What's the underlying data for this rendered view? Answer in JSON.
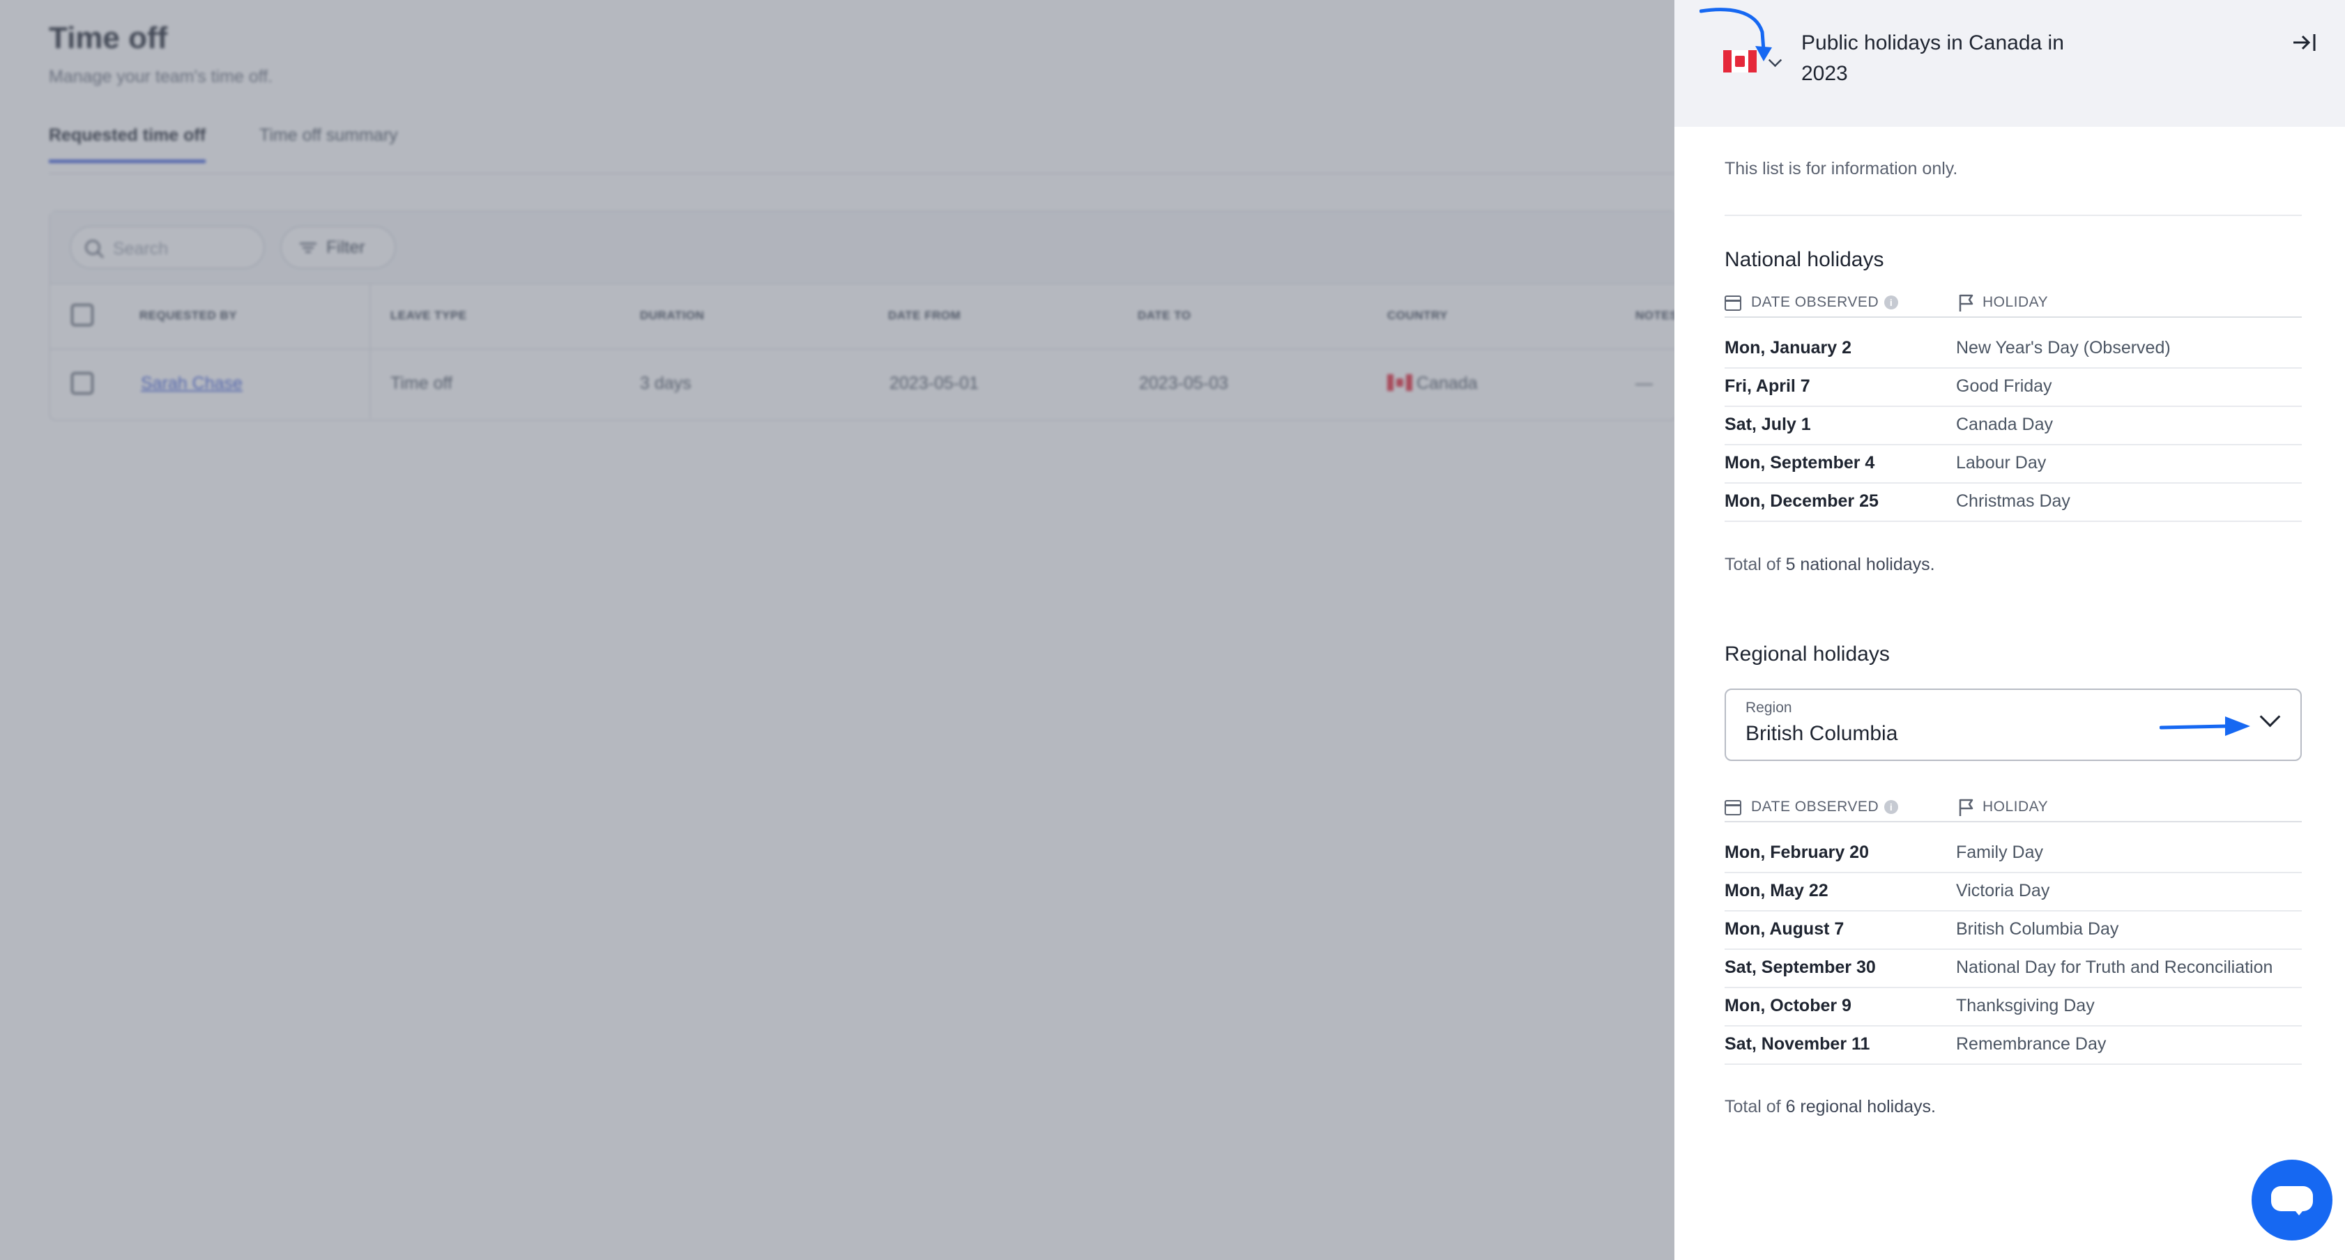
{
  "background": {
    "title": "Time off",
    "subtitle": "Manage your team's time off.",
    "tabs": [
      {
        "label": "Requested time off",
        "active": true
      },
      {
        "label": "Time off summary",
        "active": false
      }
    ],
    "search_placeholder": "Search",
    "filter_label": "Filter",
    "table": {
      "columns": [
        "REQUESTED BY",
        "LEAVE TYPE",
        "DURATION",
        "DATE FROM",
        "DATE TO",
        "COUNTRY",
        "NOTES"
      ],
      "rows": [
        {
          "requested_by": "Sarah Chase",
          "leave_type": "Time off",
          "duration": "3 days",
          "date_from": "2023-05-01",
          "date_to": "2023-05-03",
          "country": "Canada",
          "notes": "—"
        }
      ]
    }
  },
  "panel": {
    "title": "Public holidays in Canada in 2023",
    "info": "This list is for information only.",
    "columns": {
      "date": "DATE OBSERVED",
      "holiday": "HOLIDAY"
    },
    "national": {
      "title": "National holidays",
      "rows": [
        {
          "date": "Mon, January 2",
          "name": "New Year's Day (Observed)"
        },
        {
          "date": "Fri, April 7",
          "name": "Good Friday"
        },
        {
          "date": "Sat, July 1",
          "name": "Canada Day"
        },
        {
          "date": "Mon, September 4",
          "name": "Labour Day"
        },
        {
          "date": "Mon, December 25",
          "name": "Christmas Day"
        }
      ],
      "total_prefix": "Total of",
      "total_strong": "5 national holidays."
    },
    "regional": {
      "title": "Regional holidays",
      "region_label": "Region",
      "region_value": "British Columbia",
      "rows": [
        {
          "date": "Mon, February 20",
          "name": "Family Day"
        },
        {
          "date": "Mon, May 22",
          "name": "Victoria Day"
        },
        {
          "date": "Mon, August 7",
          "name": "British Columbia Day"
        },
        {
          "date": "Sat, September 30",
          "name": "National Day for Truth and Reconciliation"
        },
        {
          "date": "Mon, October 9",
          "name": "Thanksgiving Day"
        },
        {
          "date": "Sat, November 11",
          "name": "Remembrance Day"
        }
      ],
      "total_prefix": "Total of",
      "total_strong": "6 regional holidays."
    }
  },
  "icons": {
    "flag": "canada-flag-icon",
    "collapse": "collapse-panel-icon",
    "calendar": "calendar-icon",
    "holiday": "flag-outline-icon",
    "chat": "chat-bubble-icon"
  },
  "colors": {
    "accent": "#1668f2",
    "link": "#3b5bdb",
    "flag_red": "#e5283a"
  }
}
